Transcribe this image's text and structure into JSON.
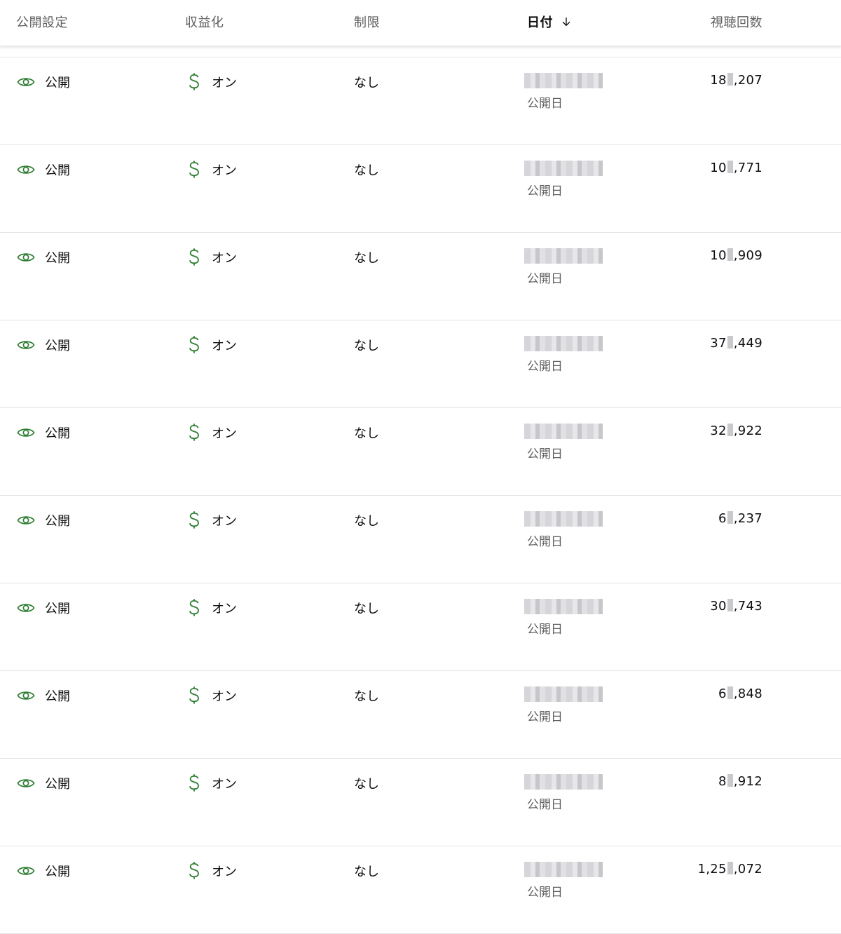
{
  "header": {
    "visibility": "公開設定",
    "monetization": "収益化",
    "restrictions": "制限",
    "date": "日付",
    "views": "視聴回数"
  },
  "colors": {
    "accent_green": "#2e7d32"
  },
  "rows": [
    {
      "visibility": "公開",
      "monetization": "オン",
      "restriction": "なし",
      "date_label": "公開日",
      "views_prefix": "18",
      "views_suffix": ",207"
    },
    {
      "visibility": "公開",
      "monetization": "オン",
      "restriction": "なし",
      "date_label": "公開日",
      "views_prefix": "10",
      "views_suffix": ",771"
    },
    {
      "visibility": "公開",
      "monetization": "オン",
      "restriction": "なし",
      "date_label": "公開日",
      "views_prefix": "10",
      "views_suffix": ",909"
    },
    {
      "visibility": "公開",
      "monetization": "オン",
      "restriction": "なし",
      "date_label": "公開日",
      "views_prefix": "37",
      "views_suffix": ",449"
    },
    {
      "visibility": "公開",
      "monetization": "オン",
      "restriction": "なし",
      "date_label": "公開日",
      "views_prefix": "32",
      "views_suffix": ",922"
    },
    {
      "visibility": "公開",
      "monetization": "オン",
      "restriction": "なし",
      "date_label": "公開日",
      "views_prefix": "6",
      "views_suffix": ",237"
    },
    {
      "visibility": "公開",
      "monetization": "オン",
      "restriction": "なし",
      "date_label": "公開日",
      "views_prefix": "30",
      "views_suffix": ",743"
    },
    {
      "visibility": "公開",
      "monetization": "オン",
      "restriction": "なし",
      "date_label": "公開日",
      "views_prefix": "6",
      "views_suffix": ",848"
    },
    {
      "visibility": "公開",
      "monetization": "オン",
      "restriction": "なし",
      "date_label": "公開日",
      "views_prefix": "8",
      "views_suffix": ",912"
    },
    {
      "visibility": "公開",
      "monetization": "オン",
      "restriction": "なし",
      "date_label": "公開日",
      "views_prefix": "1,25",
      "views_suffix": ",072"
    }
  ]
}
